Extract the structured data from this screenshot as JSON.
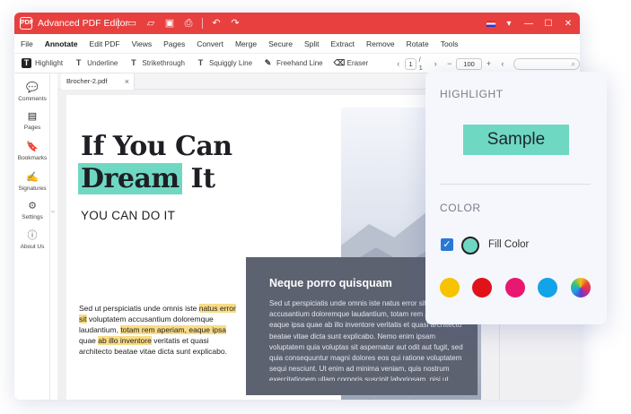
{
  "app": {
    "title": "Advanced PDF Editor",
    "logo_text": "PDF"
  },
  "menu": [
    "File",
    "Annotate",
    "Edit PDF",
    "Views",
    "Pages",
    "Convert",
    "Merge",
    "Secure",
    "Split",
    "Extract",
    "Remove",
    "Rotate",
    "Tools"
  ],
  "toolbar": {
    "tools": [
      {
        "label": "Highlight",
        "icon": "T"
      },
      {
        "label": "Underline",
        "icon": "T"
      },
      {
        "label": "Strikethrough",
        "icon": "T"
      },
      {
        "label": "Squiggly Line",
        "icon": "T"
      },
      {
        "label": "Freehand Line",
        "icon": "✎"
      },
      {
        "label": "Eraser",
        "icon": "⌫"
      }
    ],
    "page_current": "1",
    "page_total": "/ 1",
    "zoom": "100 %"
  },
  "sidebar": [
    {
      "label": "Comments",
      "icon": "💬"
    },
    {
      "label": "Pages",
      "icon": "▤"
    },
    {
      "label": "Bookmarks",
      "icon": "🔖"
    },
    {
      "label": "Signatures",
      "icon": "✍"
    },
    {
      "label": "Settings",
      "icon": "⚙"
    },
    {
      "label": "About Us",
      "icon": "ⓘ"
    }
  ],
  "tab": {
    "name": "Brocher-2.pdf",
    "close": "×"
  },
  "document": {
    "headline_1": "If You Can",
    "headline_2a": "Dream",
    "headline_2b": " It",
    "subheading": "YOU CAN DO IT",
    "para": {
      "p1": "Sed ut perspiciatis unde omnis iste ",
      "h1": "natus error sit",
      "p2": " voluptatem accusantium doloremque laudantium, ",
      "h2": "totam rem aperiam, eaque ipsa",
      "p3": " quae ",
      "h3": "ab illo inventore",
      "p4": " veritatis et quasi architecto beatae vitae dicta sunt explicabo."
    },
    "box_title": "Neque porro quisquam",
    "box_body": "Sed ut perspiciatis unde omnis iste natus error sit voluptatem accusantium doloremque laudantium, totam rem aperiam, eaque ipsa quae ab illo inventore veritatis et quasi architecto beatae vitae dicta sunt explicabo. Nemo enim ipsam voluptatem quia voluptas sit aspernatur aut odit aut fugit, sed quia consequuntur magni dolores eos qui ratione voluptatem sequi nesciunt. Ut enim ad minima veniam, quis nostrum exercitationem ullam corporis suscipit laboriosam, nisi ut aliquid ex ea commodi consequatur."
  },
  "highlight_panel": {
    "heading": "HIGHLIGHT",
    "sample": "Sample",
    "color_heading": "COLOR",
    "fill_label": "Fill Color",
    "fill_color": "#6fd8c3",
    "palette": [
      "#f7c300",
      "#e0121a",
      "#e8176f",
      "#12a3e8",
      "rainbow"
    ]
  }
}
